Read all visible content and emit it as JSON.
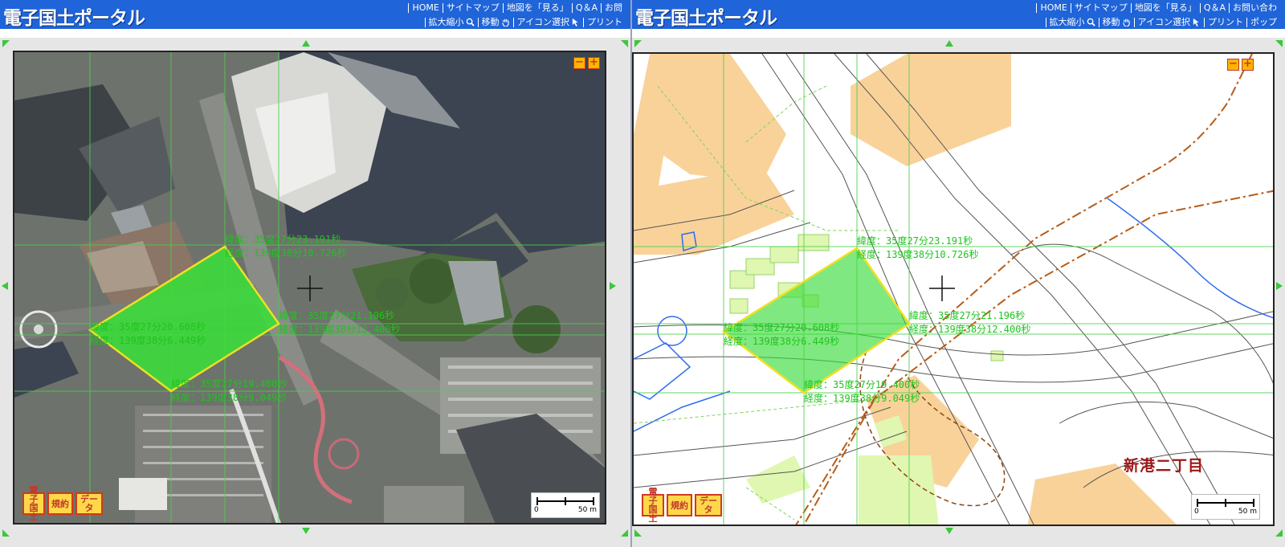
{
  "portal": {
    "logo": "電子国土ポータル",
    "nav_left": [
      "HOME",
      "サイトマップ",
      "地図を「見る」",
      "Q＆A",
      "お問"
    ],
    "nav_right": [
      "HOME",
      "サイトマップ",
      "地図を「見る」",
      "Q＆A",
      "お問い合わ"
    ],
    "tools_left": [
      "拡大縮小",
      "移動",
      "アイコン選択",
      "プリント"
    ],
    "tools_right": [
      "拡大縮小",
      "移動",
      "アイコン選択",
      "プリント",
      "ポップ"
    ]
  },
  "map_buttons": {
    "zoom_out": "−",
    "zoom_in": "+",
    "denshi_kokudo": "電子\n国土",
    "terms": "規約",
    "data": "データ"
  },
  "scale": {
    "zero": "0",
    "max": "50 m"
  },
  "coords": {
    "top_lat": "緯度：35度27分23.191秒",
    "top_lon": "経度：139度38分10.726秒",
    "right_lat": "緯度：35度27分21.196秒",
    "right_lon": "経度：139度38分12.400秒",
    "left_lat": "緯度：35度27分20.608秒",
    "left_lon": "経度：139度38分6.449秒",
    "bottom_lat": "緯度：35度27分19.400秒",
    "bottom_lon": "経度：139度38分9.049秒"
  },
  "place_name": "新港二丁目",
  "colors": {
    "header_blue": "#1f64d8",
    "polygon_fill": "#3cdc3c",
    "polygon_stroke": "#f0e020",
    "coord_text": "#1ec41e",
    "building_fill": "#f9d29a",
    "park_fill": "#dff7b0"
  }
}
